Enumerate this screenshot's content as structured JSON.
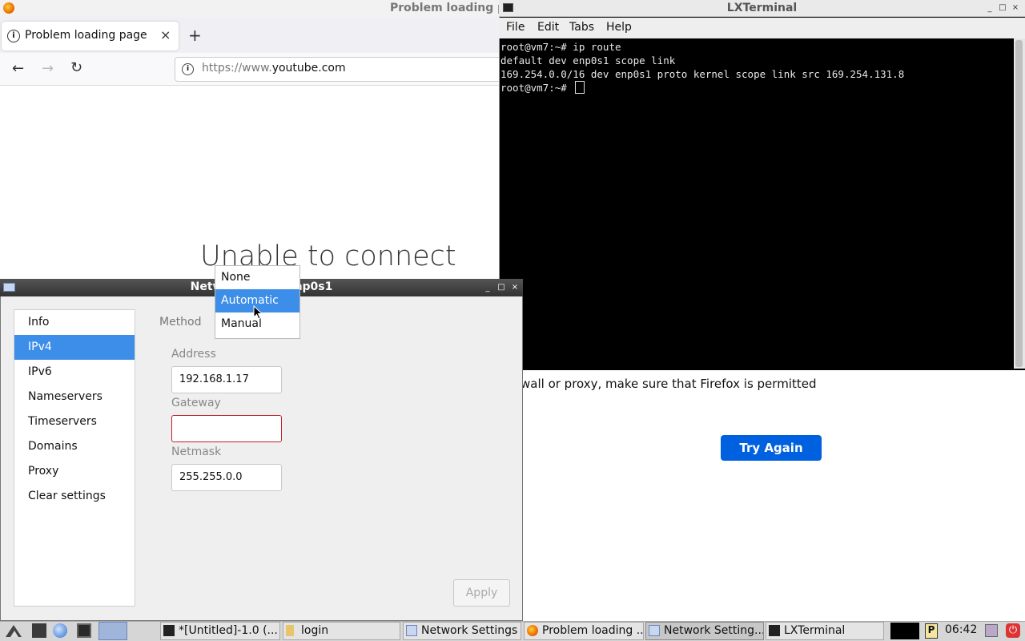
{
  "firefox": {
    "window_title": "Problem loading page",
    "tab_title": "Problem loading page",
    "tab_close": "×",
    "new_tab": "+",
    "back": "←",
    "forward": "→",
    "reload": "↻",
    "url_prefix": "https://www.",
    "url_domain": "youtube.com",
    "error_title": "Unable to connect",
    "error_text_fragment": "wall or proxy, make sure that Firefox is permitted",
    "try_again": "Try Again"
  },
  "terminal": {
    "title": "LXTerminal",
    "menu": [
      "File",
      "Edit",
      "Tabs",
      "Help"
    ],
    "lines": [
      "root@vm7:~# ip route",
      "default dev enp0s1 scope link",
      "169.254.0.0/16 dev enp0s1 proto kernel scope link src 169.254.131.8",
      "root@vm7:~# "
    ]
  },
  "network_settings": {
    "title_start": "Netwo",
    "title_end": "enp0s1",
    "sidebar": [
      "Info",
      "IPv4",
      "IPv6",
      "Nameservers",
      "Timeservers",
      "Domains",
      "Proxy",
      "Clear settings"
    ],
    "selected_sidebar": "IPv4",
    "method_label": "Method",
    "method_options": [
      "None",
      "Automatic",
      "Manual"
    ],
    "method_highlighted": "Automatic",
    "address_label": "Address",
    "address_value": "192.168.1.17",
    "gateway_label": "Gateway",
    "gateway_value": "",
    "netmask_label": "Netmask",
    "netmask_value": "255.255.0.0",
    "apply": "Apply"
  },
  "taskbar": {
    "tasks": [
      "*[Untitled]-1.0 (...",
      "login",
      "Network Settings",
      "Problem loading ...",
      "Network Setting...",
      "LXTerminal"
    ],
    "clock": "06:42"
  },
  "colors": {
    "selection": "#3d8ee8",
    "try_again_button": "#0061e0",
    "terminal_bg": "#000000",
    "error_border": "#c0202a"
  },
  "icons": [
    "firefox-logo-icon",
    "info-icon",
    "close-icon",
    "plus-icon",
    "back-arrow-icon",
    "forward-arrow-icon",
    "reload-icon",
    "terminal-icon",
    "minimize-icon",
    "maximize-icon",
    "close-window-icon",
    "network-icon",
    "folder-icon",
    "power-icon"
  ]
}
